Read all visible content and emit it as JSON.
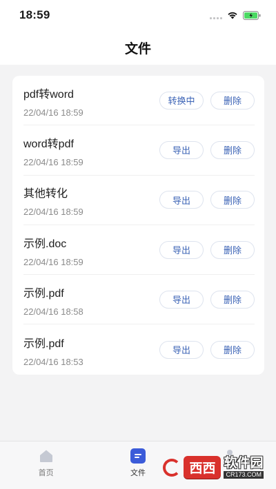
{
  "status_bar": {
    "time": "18:59"
  },
  "header": {
    "title": "文件"
  },
  "files": [
    {
      "name": "pdf转word",
      "date": "22/04/16 18:59",
      "primary_action": "转换中",
      "delete_action": "删除"
    },
    {
      "name": "word转pdf",
      "date": "22/04/16 18:59",
      "primary_action": "导出",
      "delete_action": "删除"
    },
    {
      "name": "其他转化",
      "date": "22/04/16 18:59",
      "primary_action": "导出",
      "delete_action": "删除"
    },
    {
      "name": "示例.doc",
      "date": "22/04/16 18:59",
      "primary_action": "导出",
      "delete_action": "删除"
    },
    {
      "name": "示例.pdf",
      "date": "22/04/16 18:58",
      "primary_action": "导出",
      "delete_action": "删除"
    },
    {
      "name": "示例.pdf",
      "date": "22/04/16 18:53",
      "primary_action": "导出",
      "delete_action": "删除"
    }
  ],
  "tab_bar": {
    "tabs": [
      {
        "label": "首页",
        "icon": "home-icon",
        "active": false
      },
      {
        "label": "文件",
        "icon": "file-icon",
        "active": true
      },
      {
        "label": "",
        "icon": "user-icon",
        "active": false
      }
    ]
  },
  "watermark": {
    "badge": "西西",
    "main": "软件园",
    "sub": "CR173.COM"
  },
  "colors": {
    "accent": "#3b63b6",
    "tab_active": "#3b5bd9",
    "background": "#f3f3f4"
  }
}
